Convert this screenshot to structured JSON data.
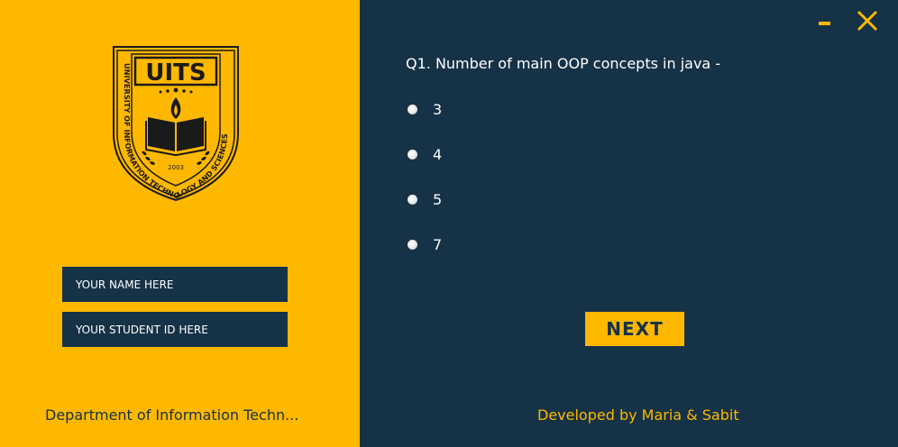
{
  "colors": {
    "accent": "#FFB800",
    "dark": "#163247",
    "text_light": "#FFFFFF"
  },
  "logo": {
    "acronym": "UITS",
    "ring_text": "UNIVERSITY OF INFORMATION TECHNOLOGY AND SCIENCES",
    "year": "2003"
  },
  "form": {
    "name_placeholder": "YOUR NAME HERE",
    "id_placeholder": "YOUR STUDENT ID HERE"
  },
  "footer": {
    "department": "Department of Information Techn...",
    "developer": "Developed by Maria & Sabit"
  },
  "window_controls": {
    "minimize_icon": "minimize-icon",
    "close_icon": "close-icon"
  },
  "quiz": {
    "question": "Q1. Number of main OOP concepts in java -",
    "options": [
      {
        "label": "3"
      },
      {
        "label": "4"
      },
      {
        "label": "5"
      },
      {
        "label": "7"
      }
    ],
    "next_label": "NEXT"
  }
}
